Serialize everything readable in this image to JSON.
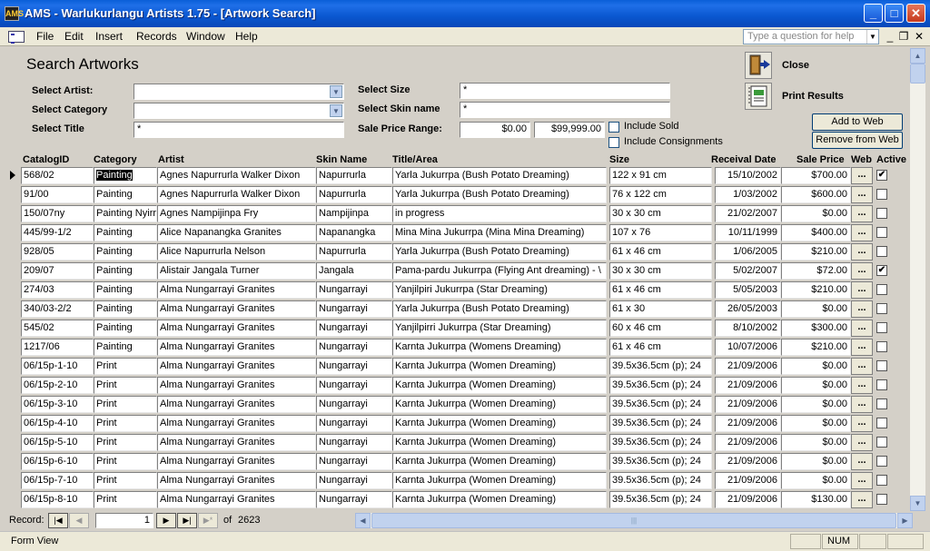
{
  "window": {
    "app_icon_text": "AMS",
    "title": "AMS - Warlukurlangu Artists 1.75 - [Artwork Search]",
    "minimize": "_",
    "maximize": "□",
    "close": "✕"
  },
  "menu": {
    "items": [
      "File",
      "Edit",
      "Insert",
      "Records",
      "Window",
      "Help"
    ],
    "help_placeholder": "Type a question for help",
    "mdi_minimize": "_",
    "mdi_restore": "❐",
    "mdi_close": "✕"
  },
  "form": {
    "heading": "Search Artworks",
    "labels": {
      "artist": "Select Artist:",
      "category": "Select Category",
      "title": "Select Title",
      "size": "Select Size",
      "skin": "Select Skin name",
      "price_range": "Sale Price Range:"
    },
    "values": {
      "artist": "",
      "category": "",
      "title": "*",
      "size": "*",
      "skin": "*",
      "price_min": "$0.00",
      "price_max": "$99,999.00"
    },
    "include_sold": "Include Sold",
    "include_consignments": "Include Consignments",
    "close_label": "Close",
    "print_label": "Print Results",
    "add_to_web": "Add to Web",
    "remove_from_web": "Remove from Web"
  },
  "columns": {
    "catalog": "CatalogID",
    "category": "Category",
    "artist": "Artist",
    "skin": "Skin Name",
    "title": "Title/Area",
    "size": "Size",
    "receival": "Receival Date",
    "price": "Sale Price",
    "web": "Web",
    "active": "Active"
  },
  "rows": [
    {
      "catalog": "568/02",
      "category": "Painting",
      "artist": "Agnes Napurrurla  Walker Dixon",
      "skin": "Napurrurla",
      "title": "Yarla  Jukurrpa (Bush Potato Dreaming)",
      "size": "122 x 91 cm",
      "receival": "15/10/2002",
      "price": "$700.00",
      "web": "...",
      "active": "✔"
    },
    {
      "catalog": "91/00",
      "category": "Painting",
      "artist": "Agnes Napurrurla  Walker Dixon",
      "skin": "Napurrurla",
      "title": "Yarla Jukurrpa (Bush Potato Dreaming)",
      "size": "76 x 122 cm",
      "receival": "1/03/2002",
      "price": "$600.00",
      "web": "...",
      "active": ""
    },
    {
      "catalog": "150/07ny",
      "category": "Painting Nyirri",
      "artist": "Agnes Nampijinpa Fry",
      "skin": "Nampijinpa",
      "title": "in progress",
      "size": "30 x 30 cm",
      "receival": "21/02/2007",
      "price": "$0.00",
      "web": "...",
      "active": ""
    },
    {
      "catalog": "445/99-1/2",
      "category": "Painting",
      "artist": "Alice Napanangka Granites",
      "skin": "Napanangka",
      "title": "Mina Mina Jukurrpa (Mina Mina Dreaming)",
      "size": "107 x 76",
      "receival": "10/11/1999",
      "price": "$400.00",
      "web": "...",
      "active": ""
    },
    {
      "catalog": "928/05",
      "category": "Painting",
      "artist": "Alice Napurrurla Nelson",
      "skin": "Napurrurla",
      "title": "Yarla Jukurrpa (Bush Potato Dreaming)",
      "size": "61 x 46 cm",
      "receival": "1/06/2005",
      "price": "$210.00",
      "web": "...",
      "active": ""
    },
    {
      "catalog": "209/07",
      "category": "Painting",
      "artist": "Alistair Jangala Turner",
      "skin": "Jangala",
      "title": "Pama-pardu Jukurrpa (Flying Ant dreaming) - \\",
      "size": "30 x 30 cm",
      "receival": "5/02/2007",
      "price": "$72.00",
      "web": "...",
      "active": "✔"
    },
    {
      "catalog": "274/03",
      "category": "Painting",
      "artist": "Alma Nungarrayi Granites",
      "skin": "Nungarrayi",
      "title": "Yanjilpiri Jukurrpa  (Star Dreaming)",
      "size": "61 x 46 cm",
      "receival": "5/05/2003",
      "price": "$210.00",
      "web": "...",
      "active": ""
    },
    {
      "catalog": "340/03-2/2",
      "category": "Painting",
      "artist": "Alma Nungarrayi Granites",
      "skin": "Nungarrayi",
      "title": "Yarla Jukurrpa (Bush Potato Dreaming)",
      "size": "61 x 30",
      "receival": "26/05/2003",
      "price": "$0.00",
      "web": "...",
      "active": ""
    },
    {
      "catalog": "545/02",
      "category": "Painting",
      "artist": "Alma Nungarrayi Granites",
      "skin": "Nungarrayi",
      "title": "Yanjilpirri Jukurrpa (Star Dreaming)",
      "size": "60 x 46 cm",
      "receival": "8/10/2002",
      "price": "$300.00",
      "web": "...",
      "active": ""
    },
    {
      "catalog": "1217/06",
      "category": "Painting",
      "artist": "Alma Nungarrayi Granites",
      "skin": "Nungarrayi",
      "title": "Karnta Jukurrpa (Womens Dreaming)",
      "size": "61 x 46 cm",
      "receival": "10/07/2006",
      "price": "$210.00",
      "web": "...",
      "active": ""
    },
    {
      "catalog": "06/15p-1-10",
      "category": "Print",
      "artist": "Alma Nungarrayi Granites",
      "skin": "Nungarrayi",
      "title": "Karnta Jukurrpa (Women Dreaming)",
      "size": "39.5x36.5cm (p); 24",
      "receival": "21/09/2006",
      "price": "$0.00",
      "web": "...",
      "active": ""
    },
    {
      "catalog": "06/15p-2-10",
      "category": "Print",
      "artist": "Alma Nungarrayi Granites",
      "skin": "Nungarrayi",
      "title": "Karnta Jukurrpa (Women Dreaming)",
      "size": "39.5x36.5cm (p); 24",
      "receival": "21/09/2006",
      "price": "$0.00",
      "web": "...",
      "active": ""
    },
    {
      "catalog": "06/15p-3-10",
      "category": "Print",
      "artist": "Alma Nungarrayi Granites",
      "skin": "Nungarrayi",
      "title": "Karnta Jukurrpa (Women Dreaming)",
      "size": "39.5x36.5cm (p); 24",
      "receival": "21/09/2006",
      "price": "$0.00",
      "web": "...",
      "active": ""
    },
    {
      "catalog": "06/15p-4-10",
      "category": "Print",
      "artist": "Alma Nungarrayi Granites",
      "skin": "Nungarrayi",
      "title": "Karnta Jukurrpa (Women Dreaming)",
      "size": "39.5x36.5cm (p); 24",
      "receival": "21/09/2006",
      "price": "$0.00",
      "web": "...",
      "active": ""
    },
    {
      "catalog": "06/15p-5-10",
      "category": "Print",
      "artist": "Alma Nungarrayi Granites",
      "skin": "Nungarrayi",
      "title": "Karnta Jukurrpa (Women Dreaming)",
      "size": "39.5x36.5cm (p); 24",
      "receival": "21/09/2006",
      "price": "$0.00",
      "web": "...",
      "active": ""
    },
    {
      "catalog": "06/15p-6-10",
      "category": "Print",
      "artist": "Alma Nungarrayi Granites",
      "skin": "Nungarrayi",
      "title": "Karnta Jukurrpa (Women Dreaming)",
      "size": "39.5x36.5cm (p); 24",
      "receival": "21/09/2006",
      "price": "$0.00",
      "web": "...",
      "active": ""
    },
    {
      "catalog": "06/15p-7-10",
      "category": "Print",
      "artist": "Alma Nungarrayi Granites",
      "skin": "Nungarrayi",
      "title": "Karnta Jukurrpa (Women Dreaming)",
      "size": "39.5x36.5cm (p); 24",
      "receival": "21/09/2006",
      "price": "$0.00",
      "web": "...",
      "active": ""
    },
    {
      "catalog": "06/15p-8-10",
      "category": "Print",
      "artist": "Alma Nungarrayi Granites",
      "skin": "Nungarrayi",
      "title": "Karnta Jukurrpa (Women Dreaming)",
      "size": "39.5x36.5cm (p); 24",
      "receival": "21/09/2006",
      "price": "$130.00",
      "web": "...",
      "active": ""
    }
  ],
  "nav": {
    "record_label": "Record:",
    "current": "1",
    "of_label": "of",
    "total": "2623",
    "first": "|◀",
    "prev": "◀",
    "next": "▶",
    "last": "▶|",
    "new": "▶*"
  },
  "status": {
    "view": "Form View",
    "num": "NUM"
  }
}
